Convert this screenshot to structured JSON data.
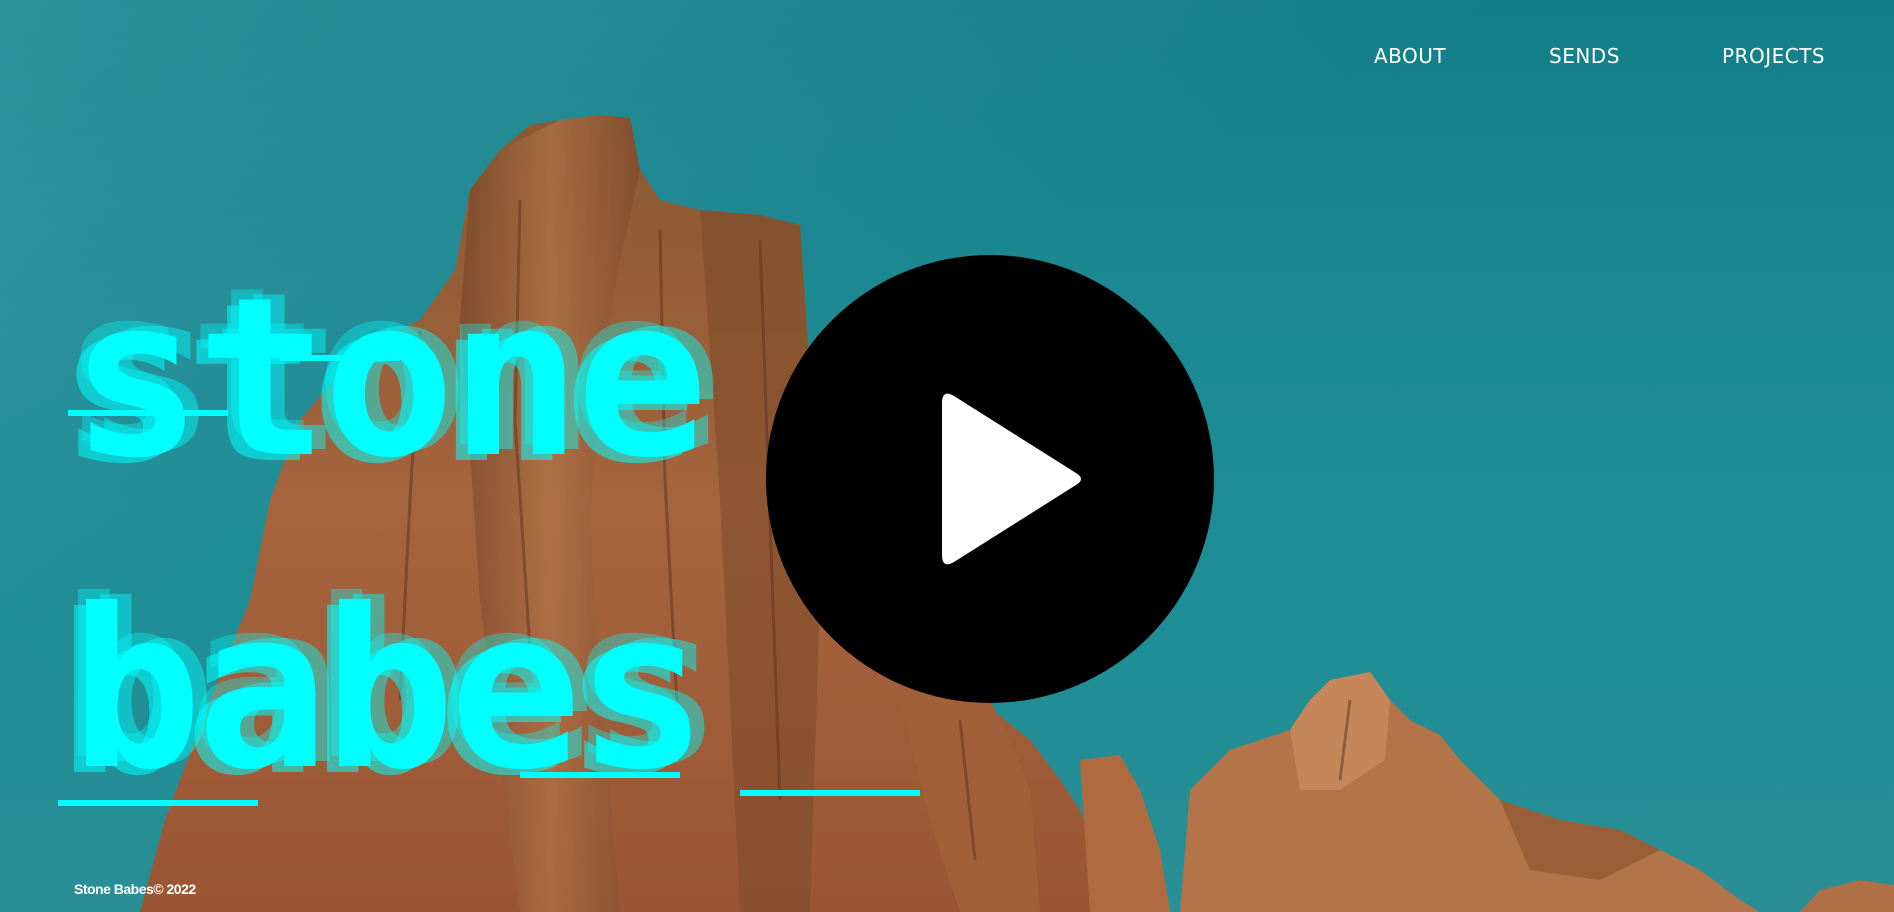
{
  "nav": {
    "items": [
      {
        "label": "ABOUT"
      },
      {
        "label": "SENDS"
      },
      {
        "label": "PROJECTS"
      }
    ]
  },
  "hero": {
    "title_line1": "stone",
    "title_line2": "babes",
    "title_color": "#00ffff",
    "sky_color": "#1a8790",
    "rock_color": "#a9643c"
  },
  "video": {
    "play_icon": "play-icon"
  },
  "footer": {
    "copyright": "Stone Babes© 2022"
  }
}
